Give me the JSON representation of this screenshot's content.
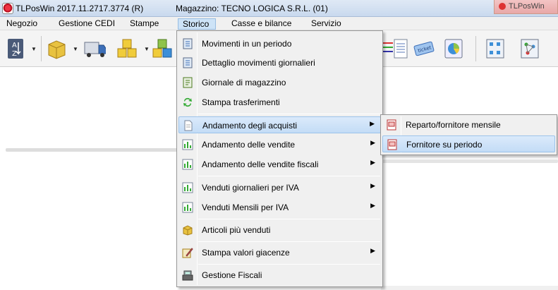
{
  "window": {
    "title": "TLPosWin 2017.11.2717.3774 (R)",
    "store": "Magazzino: TECNO LOGICA S.R.L. (01)",
    "browser_tab": "TLPosWin"
  },
  "menubar": {
    "items": [
      "Negozio",
      "Gestione CEDI",
      "Stampe",
      "Storico",
      "Casse e bilance",
      "Servizio"
    ],
    "active": "Storico"
  },
  "storico_menu": {
    "items": [
      {
        "label": "Movimenti in un periodo",
        "icon": "list-report-icon"
      },
      {
        "label": "Dettaglio movimenti giornalieri",
        "icon": "list-report-icon"
      },
      {
        "label": "Giornale di magazzino",
        "icon": "journal-icon"
      },
      {
        "label": "Stampa trasferimenti",
        "icon": "transfer-arrows-icon"
      },
      {
        "label": "Andamento degli acquisti",
        "icon": "document-icon",
        "submenu": true
      },
      {
        "label": "Andamento delle vendite",
        "icon": "bar-chart-icon",
        "submenu": true
      },
      {
        "label": "Andamento delle vendite fiscali",
        "icon": "bar-chart-icon",
        "submenu": true
      },
      {
        "label": "Venduti giornalieri per IVA",
        "icon": "bar-chart-icon",
        "submenu": true
      },
      {
        "label": "Venduti Mensili per IVA",
        "icon": "bar-chart-icon",
        "submenu": true
      },
      {
        "label": "Articoli più venduti",
        "icon": "box-icon"
      },
      {
        "label": "Stampa valori giacenze",
        "icon": "pencil-note-icon",
        "submenu": true
      },
      {
        "label": "Gestione Fiscali",
        "icon": "cash-register-icon"
      }
    ]
  },
  "acquisti_submenu": {
    "items": [
      {
        "label": "Reparto/fornitore mensile",
        "icon": "report-icon"
      },
      {
        "label": "Fornitore su periodo",
        "icon": "report-icon"
      }
    ]
  },
  "colors": {
    "highlight": "#c3dcf6",
    "menu_bg": "#f0f0f0",
    "titlebar": "#c9d9ee"
  }
}
